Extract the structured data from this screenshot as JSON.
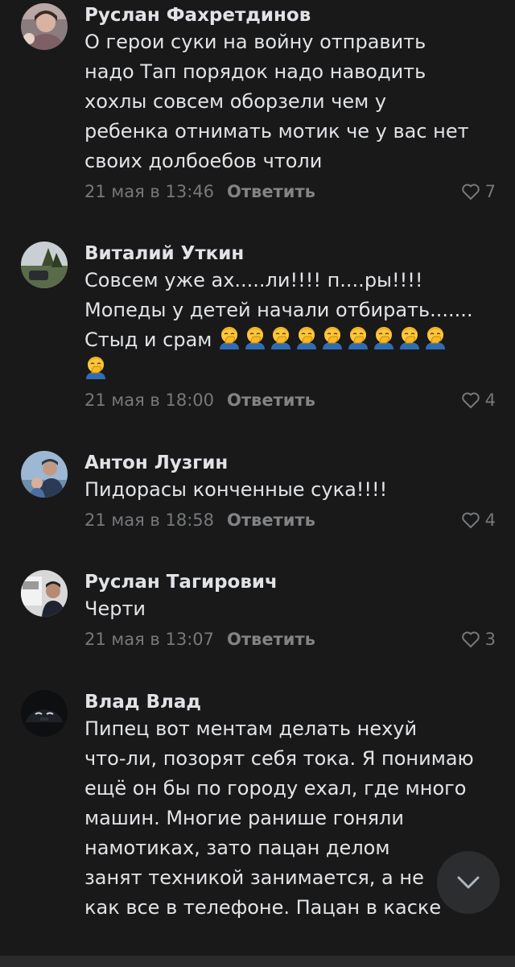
{
  "comments": [
    {
      "author": "Руслан Фахретдинов",
      "lines": [
        "О герои суки на войну отправить",
        "надо Тап порядок надо наводить",
        "хохлы совсем оборзели чем у",
        "ребенка отнимать мотик че у вас нет",
        "своих долбоебов чтоли"
      ],
      "date": "21 мая в 13:46",
      "reply_label": "Ответить",
      "likes": "7"
    },
    {
      "author": "Виталий Уткин",
      "lines": [
        "Совсем уже ах.....ли!!!! п....ры!!!!",
        "Мопеды у детей начали отбирать.......",
        "Стыд и срам"
      ],
      "emoji_name": "face-with-hand-over-mouth-emoji",
      "emoji_count_line1": 9,
      "emoji_count_line2": 1,
      "date": "21 мая в 18:00",
      "reply_label": "Ответить",
      "likes": "4"
    },
    {
      "author": "Антон Лузгин",
      "lines": [
        "Пидорасы конченные сука!!!!"
      ],
      "date": "21 мая в 18:58",
      "reply_label": "Ответить",
      "likes": "4"
    },
    {
      "author": "Руслан Тагирович",
      "lines": [
        "Черти"
      ],
      "date": "21 мая в 13:07",
      "reply_label": "Ответить",
      "likes": "3"
    },
    {
      "author": "Влад Влад",
      "lines": [
        "Пипец вот ментам делать нехуй",
        "что-ли, позорят себя тока. Я понимаю",
        "ещё он бы по городу ехал, где много",
        "машин. Многие ранише гоняли",
        "намотиках, зато пацан делом",
        "занят техникой занимается, а не",
        "как все в телефоне. Пацан в каске"
      ]
    }
  ],
  "colors": {
    "background": "#19191a",
    "text": "#e1e3e6",
    "secondary": "#76787a",
    "scroll_button": "#2c2d2f"
  },
  "icons": {
    "like": "heart-outline-icon",
    "scroll": "chevron-down-icon"
  }
}
